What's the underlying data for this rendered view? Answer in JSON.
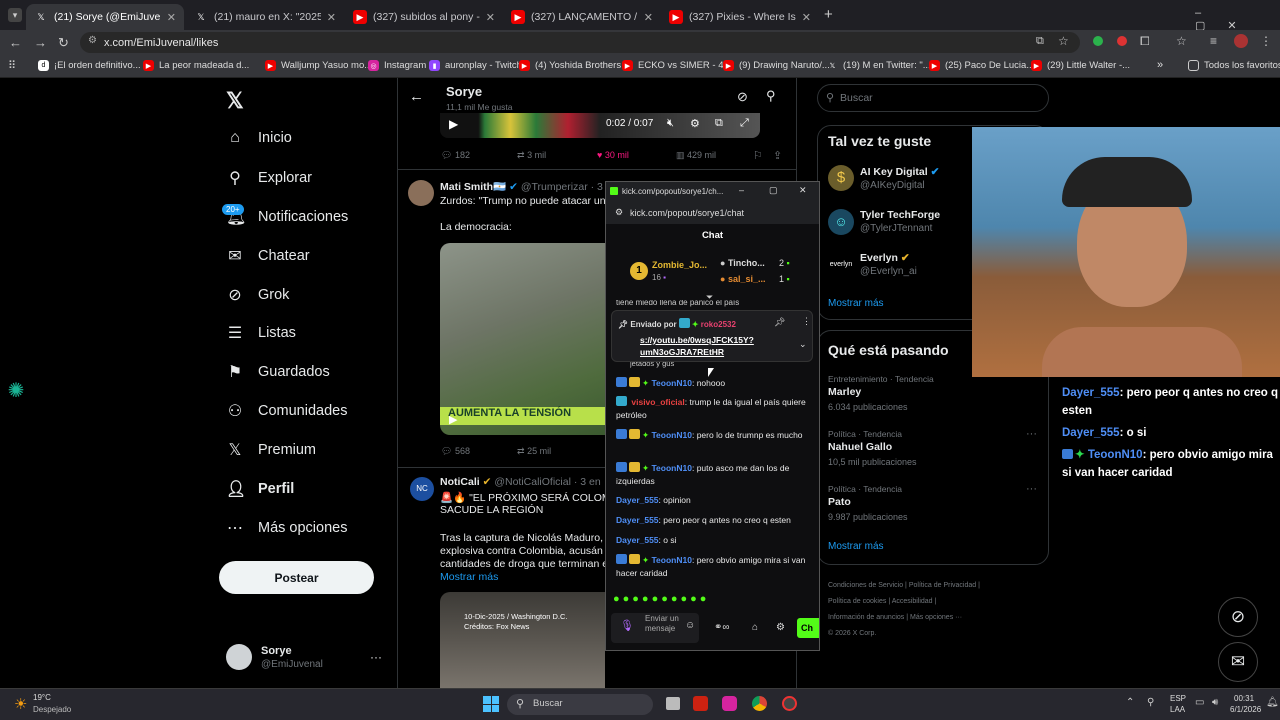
{
  "browser": {
    "tabs": [
      {
        "label": "(21) Sorye (@EmiJuvenal) / X",
        "icon": "x-icon",
        "active": true
      },
      {
        "label": "(21) mauro en X: \"2025: grok er",
        "icon": "x-icon",
        "active": false
      },
      {
        "label": "(327) subidos al pony - YouTub",
        "icon": "youtube-icon",
        "active": false
      },
      {
        "label": "(327) LANÇAMENTO / GOD OF",
        "icon": "youtube-icon",
        "active": false
      },
      {
        "label": "(327) Pixies - Where Is My Mind",
        "icon": "youtube-icon",
        "active": false
      }
    ],
    "new_tab": "+",
    "url": "x.com/EmiJuvenal/likes",
    "bookmarks": [
      {
        "label": "¡El orden definitivo...",
        "icon": "doc-icon"
      },
      {
        "label": "La peor madeada d...",
        "icon": "youtube-icon"
      },
      {
        "label": "Walljump Yasuo mo...",
        "icon": "youtube-icon"
      },
      {
        "label": "Instagram",
        "icon": "instagram-icon"
      },
      {
        "label": "auronplay - Twitch",
        "icon": "twitch-icon"
      },
      {
        "label": "(4) Yoshida Brothers...",
        "icon": "youtube-icon"
      },
      {
        "label": "ECKO vs SIMER - 4t...",
        "icon": "youtube-icon"
      },
      {
        "label": "(9) Drawing Naruto/...",
        "icon": "youtube-icon"
      },
      {
        "label": "(19) M en Twitter: \"...",
        "icon": "x-icon"
      },
      {
        "label": "(25) Paco De Lucia...",
        "icon": "youtube-icon"
      },
      {
        "label": "(29) Little Walter -...",
        "icon": "youtube-icon"
      }
    ],
    "all_favorites": "Todos los favoritos"
  },
  "x_nav": {
    "items": [
      {
        "label": "Inicio",
        "icon": "home-icon"
      },
      {
        "label": "Explorar",
        "icon": "search-icon"
      },
      {
        "label": "Notificaciones",
        "icon": "bell-icon",
        "badge": "20+"
      },
      {
        "label": "Chatear",
        "icon": "mail-icon"
      },
      {
        "label": "Grok",
        "icon": "grok-icon"
      },
      {
        "label": "Listas",
        "icon": "list-icon"
      },
      {
        "label": "Guardados",
        "icon": "bookmark-icon"
      },
      {
        "label": "Comunidades",
        "icon": "people-icon"
      },
      {
        "label": "Premium",
        "icon": "x-icon"
      },
      {
        "label": "Perfil",
        "icon": "person-icon"
      },
      {
        "label": "Más opciones",
        "icon": "more-icon"
      }
    ],
    "post_button": "Postear",
    "account": {
      "name": "Sorye",
      "handle": "@EmiJuvenal"
    }
  },
  "profile_header": {
    "name": "Sorye",
    "likes": "11,1 mil Me gusta"
  },
  "video": {
    "time": "0:02 / 0:07"
  },
  "tweets": [
    {
      "stats": {
        "replies": "182",
        "reposts": "3 mil",
        "likes": "30 mil",
        "views": "429 mil"
      }
    },
    {
      "name": "Mati Smith",
      "flag": "🇦🇷",
      "handle": "@Trumperizar",
      "time": "· 3",
      "text": "Zurdos: \"Trump no puede atacar una",
      "text2": "La democracia:",
      "banner": "AUMENTA LA TENSIÓN",
      "stats": {
        "replies": "568",
        "reposts": "25 mil"
      }
    },
    {
      "name": "NotiCali",
      "handle": "@NotiCaliOficial",
      "time": "· 3 en",
      "text": "🚨🔥 \"EL PRÓXIMO SERÁ COLOMB",
      "text_b": "SACUDE LA REGIÓN",
      "text2": "Tras la captura de Nicolás Maduro, D",
      "text3": "explosiva contra Colombia, acusán",
      "text4": "cantidades de droga que terminan e",
      "more": "Mostrar más",
      "img_caption1": "10-Dic-2025 / Washington D.C.",
      "img_caption2": "Créditos: Fox News"
    }
  ],
  "search": {
    "placeholder": "Buscar"
  },
  "who_to_follow": {
    "title": "Tal vez te guste",
    "accounts": [
      {
        "name": "AI Key Digital",
        "handle": "@AIKeyDigital"
      },
      {
        "name": "Tyler TechForge",
        "handle": "@TylerJTennant"
      },
      {
        "name": "Everlyn",
        "handle": "@Everlyn_ai"
      }
    ],
    "show_more": "Mostrar más"
  },
  "trends": {
    "title": "Qué está pasando",
    "items": [
      {
        "category": "Entretenimiento · Tendencia",
        "name": "Marley",
        "count": "6.034 publicaciones"
      },
      {
        "category": "Política · Tendencia",
        "name": "Nahuel Gallo",
        "count": "10,5 mil publicaciones"
      },
      {
        "category": "Política · Tendencia",
        "name": "Pato",
        "count": "9.987 publicaciones"
      }
    ],
    "show_more": "Mostrar más"
  },
  "footer": {
    "l1a": "Condiciones de Servicio",
    "l1b": "Política de Privacidad",
    "l2a": "Política de cookies",
    "l2b": "Accesibilidad",
    "l3a": "Información de anuncios",
    "l3b": "Más opciones ···",
    "copy": "© 2026 X Corp."
  },
  "kick": {
    "window_title": "kick.com/popout/sorye1/ch...",
    "url": "kick.com/popout/sorye1/chat",
    "chat_title": "Chat",
    "leaders": [
      {
        "rank": "1",
        "name": "Zombie_Jo...",
        "count": "16"
      },
      {
        "rank": "",
        "name": "Tincho...",
        "count": "2"
      },
      {
        "rank": "",
        "name": "sal_si_...",
        "count": "1"
      }
    ],
    "cut_line": "tiene miedo llena de pánico el país",
    "pinned": {
      "sent_by": "Enviado por",
      "user": "roko2532",
      "link1": "s://youtu.be/0wsqJFCK15Y?",
      "link2": "umN3oGJRA7REtHR",
      "cut": "jetados y gus"
    },
    "messages": [
      {
        "user": "TeoonN10",
        "text": "nohooo",
        "color": "blue",
        "badges": true
      },
      {
        "user": "visivo_oficial",
        "text": "trump le da igual el país quiere petróleo",
        "color": "red",
        "badges": false
      },
      {
        "user": "TeoonN10",
        "text": "pero lo de trumnp es mucho",
        "color": "blue",
        "badges": true
      },
      {
        "user": "TeoonN10",
        "text": "puto asco me dan los de izquierdas",
        "color": "blue",
        "badges": true
      },
      {
        "user": "Dayer_555",
        "text": "opinion",
        "color": "blue",
        "badges": false
      },
      {
        "user": "Dayer_555",
        "text": "pero peor q antes no creo q esten",
        "color": "blue",
        "badges": false
      },
      {
        "user": "Dayer_555",
        "text": "o si",
        "color": "blue",
        "badges": false
      },
      {
        "user": "TeoonN10",
        "text": "pero obvio amigo mira si van hacer caridad",
        "color": "blue",
        "badges": true
      }
    ],
    "input_placeholder": "Enviar un mensaje",
    "send": "Ch"
  },
  "overlay": {
    "messages": [
      {
        "user": "Dayer_555",
        "text": "pero peor q antes no creo q esten"
      },
      {
        "user": "Dayer_555",
        "text": "o si"
      },
      {
        "user": "TeoonN10",
        "text": "pero obvio amigo mira si van hacer caridad"
      }
    ]
  },
  "taskbar": {
    "weather_temp": "19°C",
    "weather_desc": "Despejado",
    "search": "Buscar",
    "lang1": "ESP",
    "lang2": "LAA",
    "time": "00:31",
    "date": "6/1/2026"
  }
}
